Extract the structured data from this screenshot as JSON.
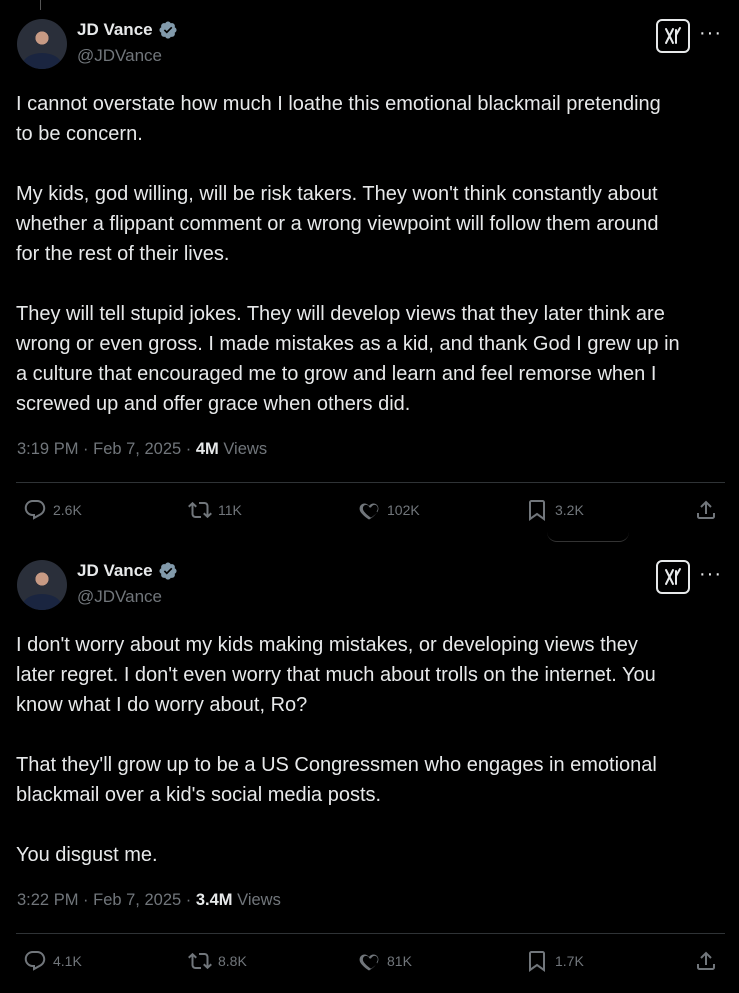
{
  "tweets": [
    {
      "author_name": "JD Vance",
      "handle": "@JDVance",
      "text": "I cannot overstate how much I loathe this emotional blackmail pretending\nto be concern.\n\nMy kids, god willing, will be risk takers. They won't think constantly about\nwhether a flippant comment or a wrong viewpoint will follow them around\nfor the rest of their lives.\n\nThey will tell stupid jokes. They will develop views that they later think are\nwrong or even gross. I made mistakes as a kid, and thank God I grew up in\na culture that encouraged me to grow and learn and feel remorse when I\nscrewed up and offer grace when others did.",
      "time": "3:19 PM · Feb 7, 2025 · ",
      "views_count": "4M",
      "views_label": " Views",
      "replies": "2.6K",
      "reposts": "11K",
      "likes": "102K",
      "bookmarks": "3.2K"
    },
    {
      "author_name": "JD Vance",
      "handle": "@JDVance",
      "text": "I don't worry about my kids making mistakes, or developing views they\nlater regret. I don't even worry that much about trolls on the internet. You\nknow what I do worry about, Ro?\n\nThat they'll grow up to be a US Congressmen who engages in emotional\nblackmail over a kid's social media posts.\n\nYou disgust me.",
      "time": "3:22 PM · Feb 7, 2025 · ",
      "views_count": "3.4M",
      "views_label": " Views",
      "replies": "4.1K",
      "reposts": "8.8K",
      "likes": "81K",
      "bookmarks": "1.7K"
    }
  ],
  "icons": {
    "verified": "verified-badge-icon",
    "grok": "grok-icon",
    "more": "more-icon",
    "reply": "reply-icon",
    "repost": "repost-icon",
    "like": "heart-icon",
    "bookmark": "bookmark-icon",
    "share": "share-icon"
  },
  "colors": {
    "background": "#000000",
    "text": "#e7e9ea",
    "secondary": "#71767b",
    "verified": "#829aab",
    "divider": "#2f3336"
  }
}
